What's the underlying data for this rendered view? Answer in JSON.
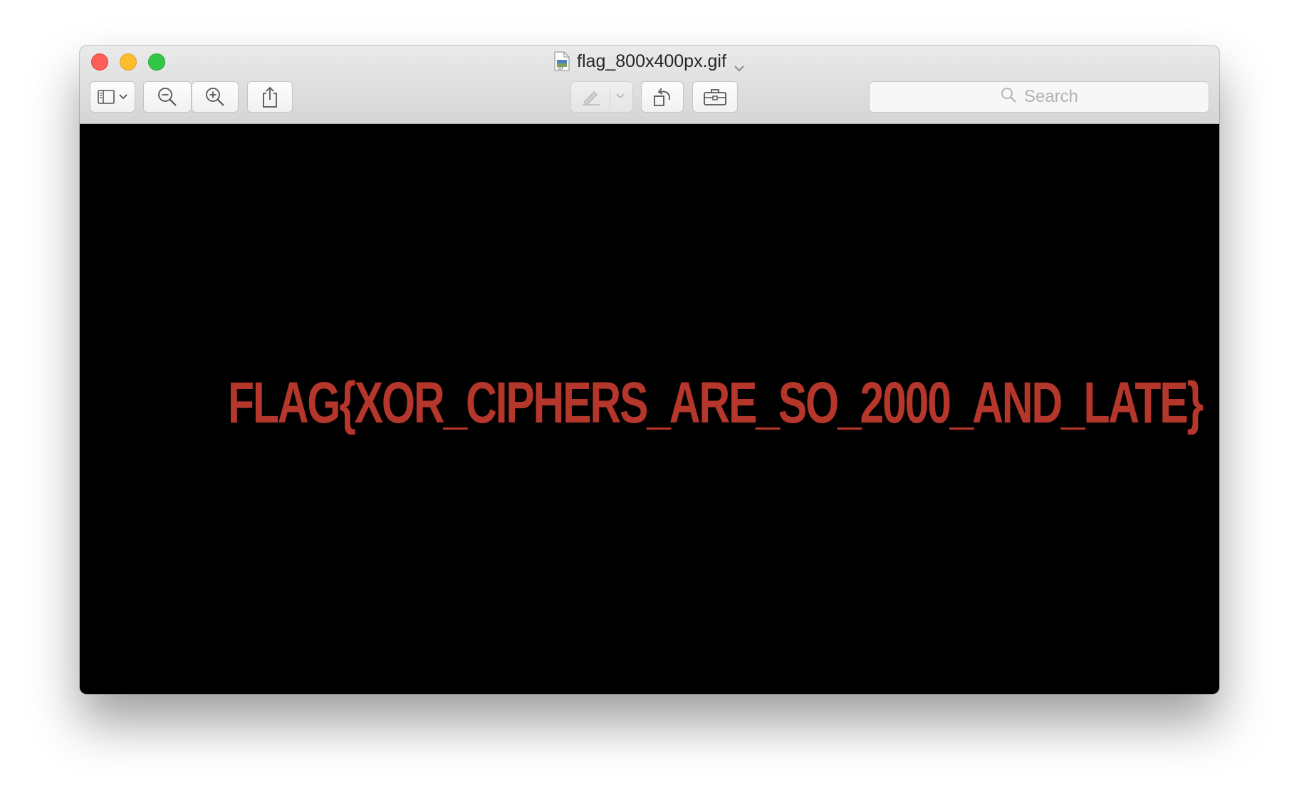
{
  "window": {
    "title": "flag_800x400px.gif"
  },
  "toolbar": {
    "search_placeholder": "Search"
  },
  "image": {
    "text": "FLAG{XOR_CIPHERS_ARE_SO_2000_AND_LATE}",
    "text_color": "#b5362a",
    "background_color": "#000000"
  },
  "icons": {
    "sidebar": "sidebar-icon",
    "zoom_out": "zoom-out-icon",
    "zoom_in": "zoom-in-icon",
    "share": "share-icon",
    "markup": "markup-pen-icon",
    "rotate": "rotate-left-icon",
    "toolbox": "toolbox-icon",
    "search": "search-icon"
  }
}
